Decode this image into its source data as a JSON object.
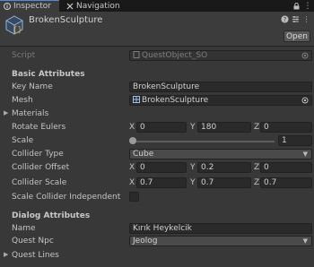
{
  "tabs": {
    "inspector": "Inspector",
    "navigation": "Navigation"
  },
  "header": {
    "object_name": "BrokenSculpture",
    "open_label": "Open"
  },
  "script": {
    "label": "Script",
    "value": "QuestObject_SO"
  },
  "basic": {
    "title": "Basic Attributes",
    "key_name_label": "Key Name",
    "key_name_value": "BrokenSculpture",
    "mesh_label": "Mesh",
    "mesh_value": "BrokenSculpture",
    "materials_label": "Materials",
    "rotate_label": "Rotate Eulers",
    "rotate": {
      "x": "0",
      "y": "180",
      "z": "0"
    },
    "scale_label": "Scale",
    "scale_value": "1",
    "collider_type_label": "Collider Type",
    "collider_type_value": "Cube",
    "collider_offset_label": "Collider Offset",
    "collider_offset": {
      "x": "0",
      "y": "0.2",
      "z": "0"
    },
    "collider_scale_label": "Collider Scale",
    "collider_scale": {
      "x": "0.7",
      "y": "0.7",
      "z": "0.7"
    },
    "scale_indep_label": "Scale Collider Independent"
  },
  "axes": {
    "x": "X",
    "y": "Y",
    "z": "Z"
  },
  "dialog": {
    "title": "Dialog Attributes",
    "name_label": "Name",
    "name_value": "Kırık Heykelcik",
    "npc_label": "Quest Npc",
    "npc_value": "Jeolog",
    "quest_lines_label": "Quest Lines"
  },
  "colors": {
    "accent": "#4a8fdc",
    "background": "#383838",
    "field": "#2a2a2a"
  }
}
